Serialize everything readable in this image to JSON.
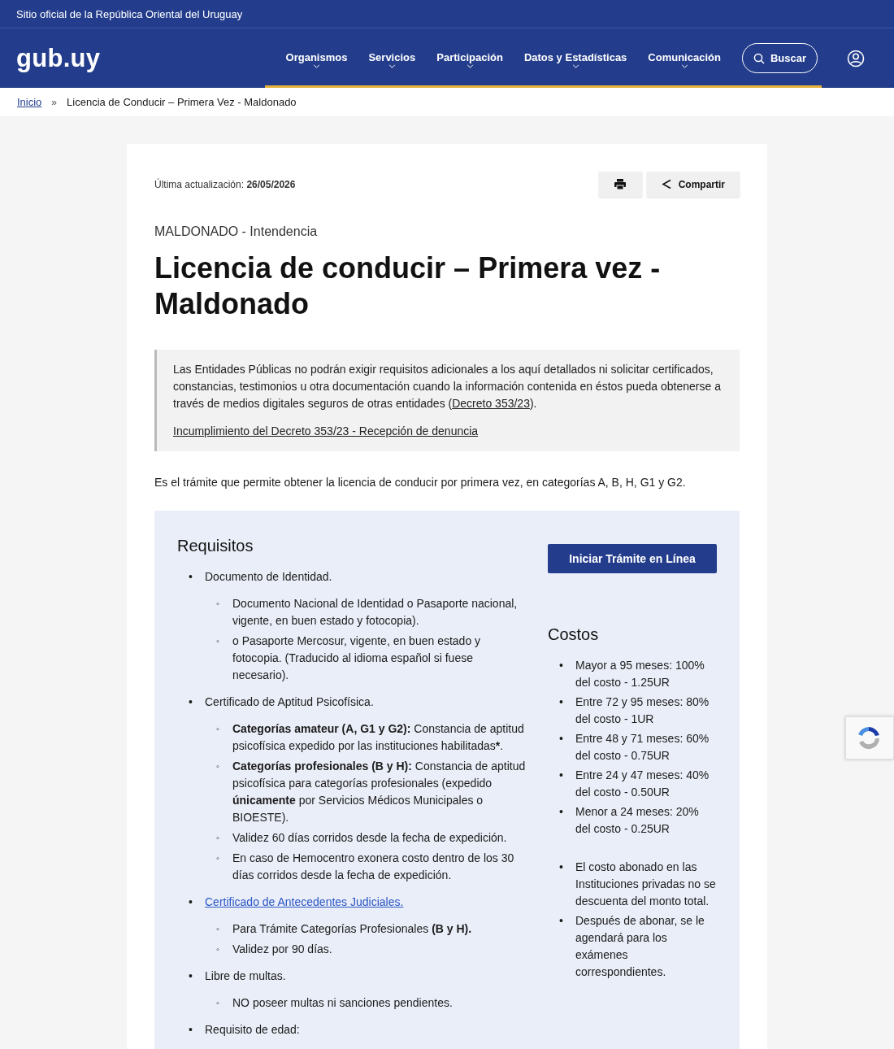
{
  "top_bar": {
    "text": "Sitio oficial de la República Oriental del Uruguay"
  },
  "header": {
    "logo": "gub.uy",
    "nav": [
      {
        "label": "Organismos"
      },
      {
        "label": "Servicios"
      },
      {
        "label": "Participación"
      },
      {
        "label": "Datos y Estadísticas"
      },
      {
        "label": "Comunicación"
      }
    ],
    "search_button": "Buscar"
  },
  "breadcrumb": [
    {
      "label": "Inicio",
      "kind": "link"
    },
    {
      "label": "»",
      "kind": "separator"
    },
    {
      "label": "Licencia de Conducir – Primera Vez - Maldonado",
      "kind": "current"
    }
  ],
  "page": {
    "updated_label": "Última actualización:",
    "updated_date": "26/05/2026",
    "share_button": "Compartir",
    "organism": "MALDONADO - Intendencia",
    "title": "Licencia de conducir – Primera vez - Maldonado",
    "notice": {
      "text_before": "Las Entidades Públicas no podrán exigir requisitos adicionales a los aquí detallados ni solicitar certificados, constancias, testimonios u otra documentación cuando la información contenida en éstos pueda obtenerse a través de medios digitales seguros de otras entidades (",
      "link": "Decreto 353/23",
      "text_after": ").",
      "complaint_link": "Incumplimiento del Decreto 353/23 - Recepción de denuncia"
    },
    "description": "Es el trámite que permite obtener la licencia de conducir por primera vez, en categorías A, B, H, G1 y G2.",
    "requirements": {
      "heading": "Requisitos",
      "items": [
        {
          "marker": "•",
          "text": "Documento de Identidad.",
          "kind": "text",
          "children": [
            {
              "marker": "◦",
              "text": "Documento Nacional de Identidad o Pasaporte nacional, vigente, en buen estado y  fotocopia)."
            },
            {
              "marker": "◦",
              "text": "o Pasaporte Mercosur, vigente, en buen estado y fotocopia. (Traducido al idioma español si fuese necesario)."
            }
          ]
        },
        {
          "marker": "•",
          "text": "Certificado de Aptitud Psicofísica.",
          "kind": "text",
          "children": [
            {
              "marker": "◦",
              "text": "**Categorías amateur (A, G1 y G2):** Constancia de aptitud psicofísica expedido por las instituciones habilitadas",
              "footnote_mark": "*",
              "footnote_tail": "."
            },
            {
              "marker": "◦",
              "text": "**Categorías profesionales (B y H):** Constancia de aptitud psicofísica para categorías profesionales (expedido **únicamente** por Servicios Médicos Municipales o BIOESTE)."
            },
            {
              "marker": "◦",
              "text": "Validez 60 días corridos desde la fecha de expedición."
            },
            {
              "marker": "◦",
              "text": "En caso de Hemocentro exonera costo dentro de los 30 días corridos desde la fecha de expedición."
            }
          ]
        },
        {
          "marker": "•",
          "text": "Certificado de Antecedentes Judiciales.",
          "kind": "link",
          "children": [
            {
              "marker": "◦",
              "text": "Para Trámite Categorías Profesionales **(B y H).**"
            },
            {
              "marker": "◦",
              "text": "Validez por 90 días."
            }
          ]
        },
        {
          "marker": "•",
          "text": "Libre de multas.",
          "kind": "text",
          "children": [
            {
              "marker": "◦",
              "text": "NO poseer multas ni sanciones pendientes."
            }
          ]
        },
        {
          "marker": "•",
          "text": "Requisito de edad:",
          "kind": "text"
        }
      ]
    },
    "start_button": "Iniciar Trámite en Línea",
    "costs": {
      "heading": "Costos",
      "groups": [
        [
          {
            "marker": "•",
            "text": "Mayor a 95 meses: 100% del costo - 1.25UR"
          },
          {
            "marker": "•",
            "text": "Entre 72 y 95 meses: 80% del costo - 1UR"
          },
          {
            "marker": "•",
            "text": "Entre 48 y 71 meses: 60% del costo - 0.75UR"
          },
          {
            "marker": "•",
            "text": "Entre 24 y 47 meses: 40% del costo - 0.50UR"
          },
          {
            "marker": "•",
            "text": "Menor a 24 meses: 20% del costo - 0.25UR"
          }
        ],
        [
          {
            "marker": "•",
            "text": "El costo abonado en las Instituciones privadas no se descuenta del monto total."
          },
          {
            "marker": "•",
            "text": "Después de abonar, se le agendará para los exámenes correspondientes."
          }
        ]
      ]
    }
  }
}
